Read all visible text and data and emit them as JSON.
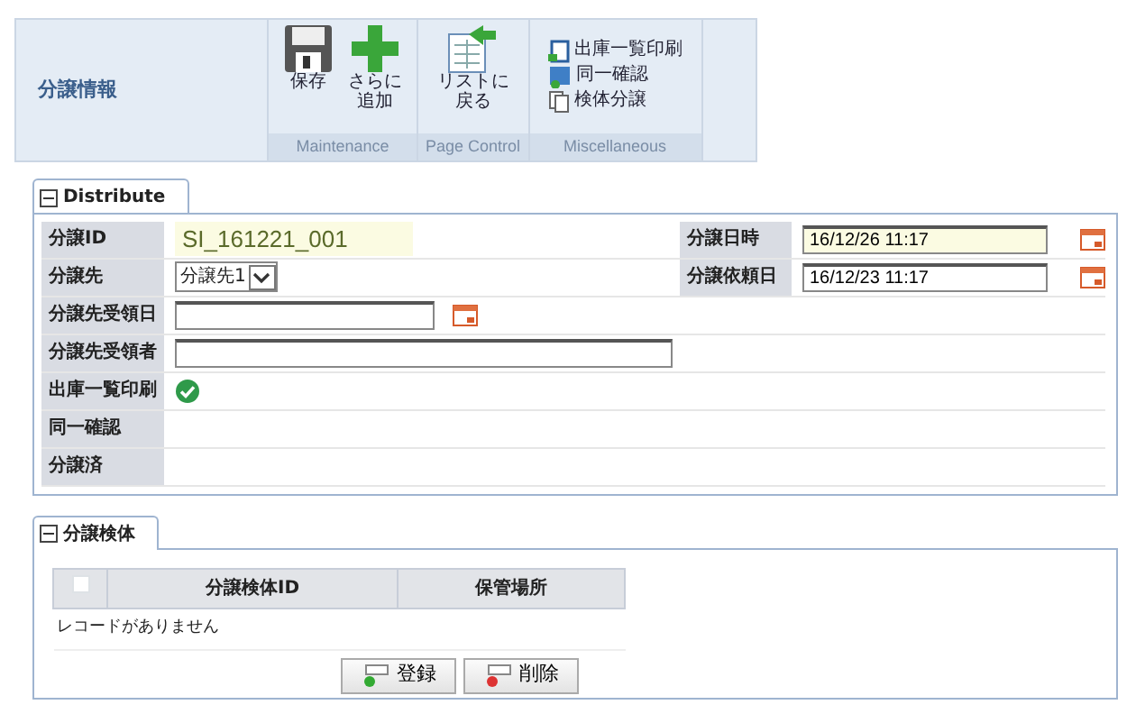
{
  "header": {
    "title": "分譲情報"
  },
  "toolbar_groups": [
    {
      "label": "Maintenance",
      "kind": "large",
      "buttons": [
        {
          "kind": "save",
          "lines": [
            "保存"
          ]
        },
        {
          "kind": "add",
          "lines": [
            "さらに",
            "追加"
          ]
        }
      ]
    },
    {
      "label": "Page Control",
      "kind": "large",
      "buttons": [
        {
          "kind": "back",
          "lines": [
            "リストに",
            "戻る"
          ]
        }
      ]
    },
    {
      "label": "Miscellaneous",
      "kind": "small",
      "buttons": [
        {
          "kind": "print",
          "lines": [
            "出庫一覧印刷"
          ]
        },
        {
          "kind": "confirm",
          "lines": [
            "同一確認"
          ]
        },
        {
          "kind": "copy",
          "lines": [
            "検体分譲"
          ]
        }
      ]
    }
  ],
  "distribute": {
    "title": "Distribute",
    "expanded": true,
    "rows": [
      {
        "label": "分譲ID",
        "field": {
          "kind": "text",
          "value": "SI_161221_001",
          "highlighted": true
        },
        "right": {
          "label": "分譲日時",
          "field": {
            "kind": "date",
            "value": "16/12/26 11:17",
            "highlighted": true
          }
        }
      },
      {
        "label": "分譲先",
        "field": {
          "kind": "select",
          "value": "分譲先1"
        },
        "right": {
          "label": "分譲依頼日",
          "field": {
            "kind": "date",
            "value": "16/12/23 11:17",
            "highlighted": false
          }
        }
      },
      {
        "label": "分譲先受領日",
        "field": {
          "kind": "date",
          "highlighted": false
        }
      },
      {
        "label": "分譲先受領者",
        "field": {
          "kind": "input"
        }
      },
      {
        "label": "出庫一覧印刷",
        "field": {
          "kind": "check",
          "checked": true
        }
      },
      {
        "label": "同一確認",
        "field": {
          "kind": "check",
          "checked": false
        }
      },
      {
        "label": "分譲済",
        "field": {
          "kind": "check",
          "checked": false
        }
      }
    ]
  },
  "samples": {
    "title": "分譲検体",
    "expanded": true,
    "select_all": false,
    "columns": [
      "分譲検体ID",
      "保管場所"
    ],
    "empty_message": "レコードがありません",
    "buttons": [
      {
        "kind": "register",
        "label": "登録"
      },
      {
        "kind": "delete",
        "label": "削除"
      }
    ]
  }
}
